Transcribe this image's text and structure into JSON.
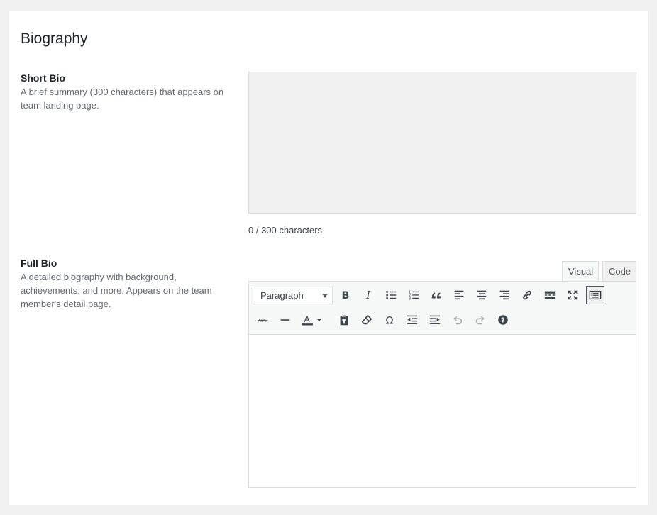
{
  "section": {
    "title": "Biography"
  },
  "short_bio": {
    "label": "Short Bio",
    "description": "A brief summary (300 characters) that appears on team landing page.",
    "value": "",
    "counter": "0 / 300 characters"
  },
  "full_bio": {
    "label": "Full Bio",
    "description": "A detailed biography with background, achievements, and more. Appears on the team member's detail page.",
    "tabs": {
      "visual": "Visual",
      "code": "Code",
      "active": "Visual"
    },
    "format_select": "Paragraph",
    "toolbar_row1": [
      "bold-icon",
      "italic-icon",
      "bulleted-list-icon",
      "numbered-list-icon",
      "blockquote-icon",
      "align-left-icon",
      "align-center-icon",
      "align-right-icon",
      "link-icon",
      "read-more-icon",
      "fullscreen-icon",
      "toolbar-toggle-icon"
    ],
    "toolbar_row2": [
      "strikethrough-icon",
      "horizontal-line-icon",
      "text-color-icon",
      "paste-as-text-icon",
      "clear-formatting-icon",
      "special-character-icon",
      "outdent-icon",
      "indent-icon",
      "undo-icon",
      "redo-icon",
      "help-icon"
    ],
    "content": ""
  },
  "colors": {
    "page_bg": "#f0f0f1",
    "panel_bg": "#ffffff",
    "field_bg": "#f0f0f1",
    "border": "#dcdcde",
    "toolbar_bg": "#f6f7f7",
    "icon": "#3c434a",
    "muted_text": "#646970"
  }
}
